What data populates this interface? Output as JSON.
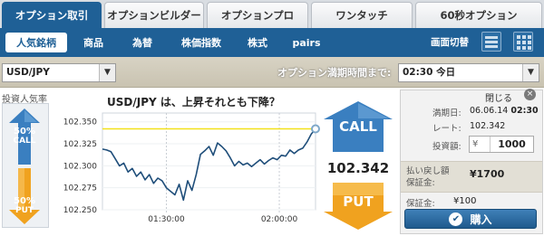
{
  "tabs": [
    {
      "label": "オプション取引",
      "active": true
    },
    {
      "label": "オプションビルダー",
      "active": false
    },
    {
      "label": "オプションプロ",
      "active": false
    },
    {
      "label": "ワンタッチ",
      "active": false
    },
    {
      "label": "60秒オプション",
      "active": false
    }
  ],
  "categories": [
    {
      "label": "人気銘柄",
      "active": true
    },
    {
      "label": "商品",
      "active": false
    },
    {
      "label": "為替",
      "active": false
    },
    {
      "label": "株価指数",
      "active": false
    },
    {
      "label": "株式",
      "active": false
    },
    {
      "label": "pairs",
      "active": false
    }
  ],
  "view": {
    "label": "画面切替"
  },
  "asset_select": {
    "value": "USD/JPY"
  },
  "expiry": {
    "label": "オプション満期時間まで:",
    "value": "02:30 今日"
  },
  "sentiment": {
    "title": "投資人気率",
    "call_percent": "50%",
    "call_label": "CALL",
    "put_percent": "50%",
    "put_label": "PUT"
  },
  "chart_title": "USD/JPY は、上昇それとも下降？",
  "chart_data": {
    "type": "line",
    "ylim": [
      102.25,
      102.36
    ],
    "y_ticks": [
      "102.350",
      "102.325",
      "102.300",
      "102.275",
      "102.250"
    ],
    "x_ticks": [
      "01:30:00",
      "02:00:00"
    ],
    "target_line": 102.342,
    "points": [
      [
        0.0,
        102.319
      ],
      [
        0.02,
        102.318
      ],
      [
        0.04,
        102.316
      ],
      [
        0.06,
        102.308
      ],
      [
        0.08,
        102.3
      ],
      [
        0.1,
        102.303
      ],
      [
        0.12,
        102.293
      ],
      [
        0.14,
        102.297
      ],
      [
        0.16,
        102.288
      ],
      [
        0.18,
        102.293
      ],
      [
        0.2,
        102.284
      ],
      [
        0.22,
        102.29
      ],
      [
        0.24,
        102.28
      ],
      [
        0.26,
        102.286
      ],
      [
        0.28,
        102.283
      ],
      [
        0.3,
        102.275
      ],
      [
        0.32,
        102.271
      ],
      [
        0.34,
        102.267
      ],
      [
        0.36,
        102.279
      ],
      [
        0.38,
        102.261
      ],
      [
        0.4,
        102.283
      ],
      [
        0.42,
        102.272
      ],
      [
        0.44,
        102.29
      ],
      [
        0.46,
        102.313
      ],
      [
        0.48,
        102.317
      ],
      [
        0.5,
        102.322
      ],
      [
        0.52,
        102.312
      ],
      [
        0.54,
        102.326
      ],
      [
        0.56,
        102.322
      ],
      [
        0.58,
        102.317
      ],
      [
        0.6,
        102.309
      ],
      [
        0.62,
        102.3
      ],
      [
        0.64,
        102.305
      ],
      [
        0.66,
        102.301
      ],
      [
        0.68,
        102.303
      ],
      [
        0.7,
        102.299
      ],
      [
        0.72,
        102.303
      ],
      [
        0.74,
        102.307
      ],
      [
        0.76,
        102.302
      ],
      [
        0.78,
        102.306
      ],
      [
        0.8,
        102.309
      ],
      [
        0.82,
        102.307
      ],
      [
        0.84,
        102.312
      ],
      [
        0.86,
        102.311
      ],
      [
        0.88,
        102.318
      ],
      [
        0.9,
        102.314
      ],
      [
        0.92,
        102.318
      ],
      [
        0.94,
        102.32
      ],
      [
        0.96,
        102.327
      ],
      [
        0.98,
        102.336
      ],
      [
        1.0,
        102.342
      ]
    ],
    "current_price": "102.342"
  },
  "call_button": {
    "label": "CALL"
  },
  "put_button": {
    "label": "PUT"
  },
  "order": {
    "close_label": "閉じる",
    "close_icon": "×",
    "expiry_label": "満期日:",
    "expiry_date": "06.06.14",
    "expiry_time": "02:30",
    "rate_label": "レート:",
    "rate_value": "102.342",
    "invest_label": "投資額:",
    "currency": "¥",
    "invest_value": "1000",
    "payout_label_1": "払い戻し額",
    "payout_label_2": "保証金:",
    "payout_value": "¥1700",
    "deposit_label": "保証金:",
    "deposit_value": "¥100",
    "buy_label": "購入",
    "buy_icon": "✔"
  },
  "colors": {
    "brand": "#1f6096",
    "call": "#3a7fc0",
    "put": "#f0a21f",
    "line": "#1f4e7a",
    "target": "#f5e11a"
  }
}
